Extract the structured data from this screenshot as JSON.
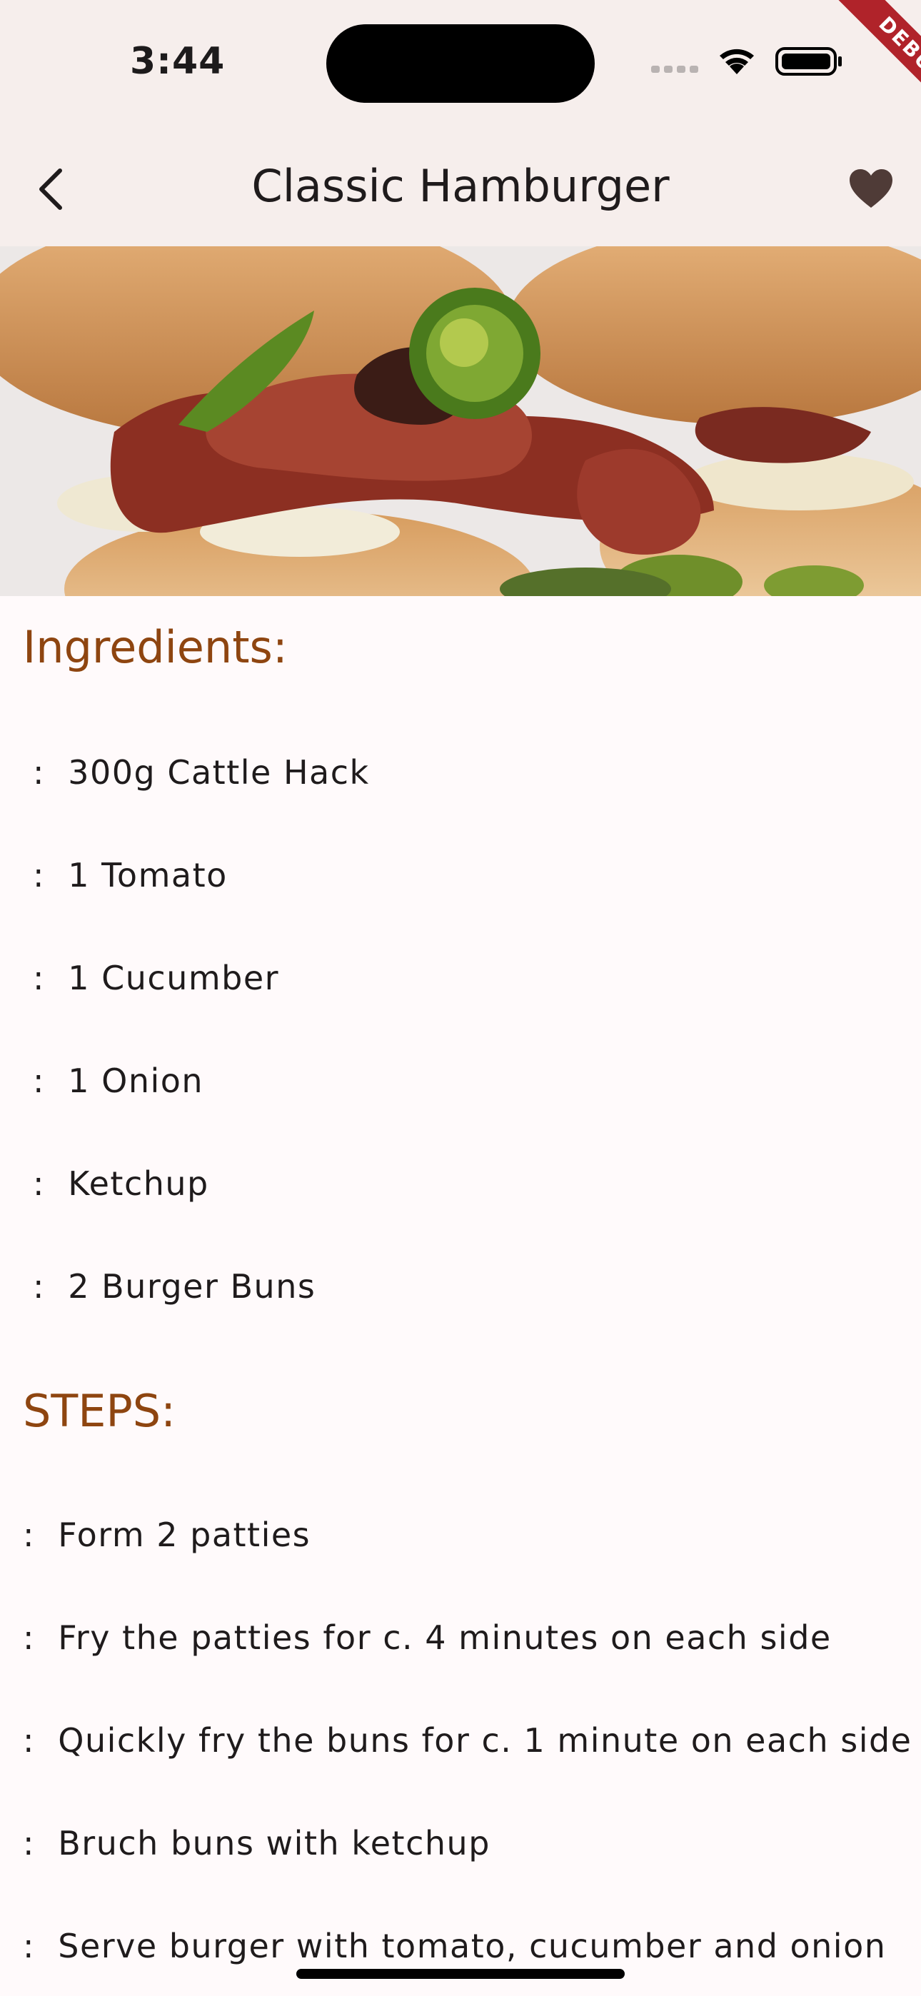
{
  "status_bar": {
    "time": "3:44"
  },
  "debug_banner": "DEBUG",
  "app_bar": {
    "title": "Classic Hamburger",
    "back_icon": "chevron-left-icon",
    "favorite_icon": "heart-filled-icon"
  },
  "hero_image": {
    "subject": "burger-photo"
  },
  "ingredients": {
    "heading": "Ingredients:",
    "items": [
      {
        "bullet": ":",
        "text": "300g Cattle Hack"
      },
      {
        "bullet": ":",
        "text": "1 Tomato"
      },
      {
        "bullet": ":",
        "text": "1 Cucumber"
      },
      {
        "bullet": ":",
        "text": "1 Onion"
      },
      {
        "bullet": ":",
        "text": "Ketchup"
      },
      {
        "bullet": ":",
        "text": "2 Burger Buns"
      }
    ]
  },
  "steps": {
    "heading": "STEPS:",
    "items": [
      {
        "bullet": ":",
        "text": "Form 2 patties"
      },
      {
        "bullet": ":",
        "text": "Fry the patties for c. 4 minutes on each side"
      },
      {
        "bullet": ":",
        "text": "Quickly fry the buns for c. 1 minute on each side"
      },
      {
        "bullet": ":",
        "text": "Bruch buns with ketchup"
      },
      {
        "bullet": ":",
        "text": "Serve burger with tomato, cucumber and onion"
      }
    ]
  },
  "colors": {
    "app_bar_bg": "#f6eeec",
    "section_heading": "#8e4510",
    "page_bg": "#fffafb"
  }
}
